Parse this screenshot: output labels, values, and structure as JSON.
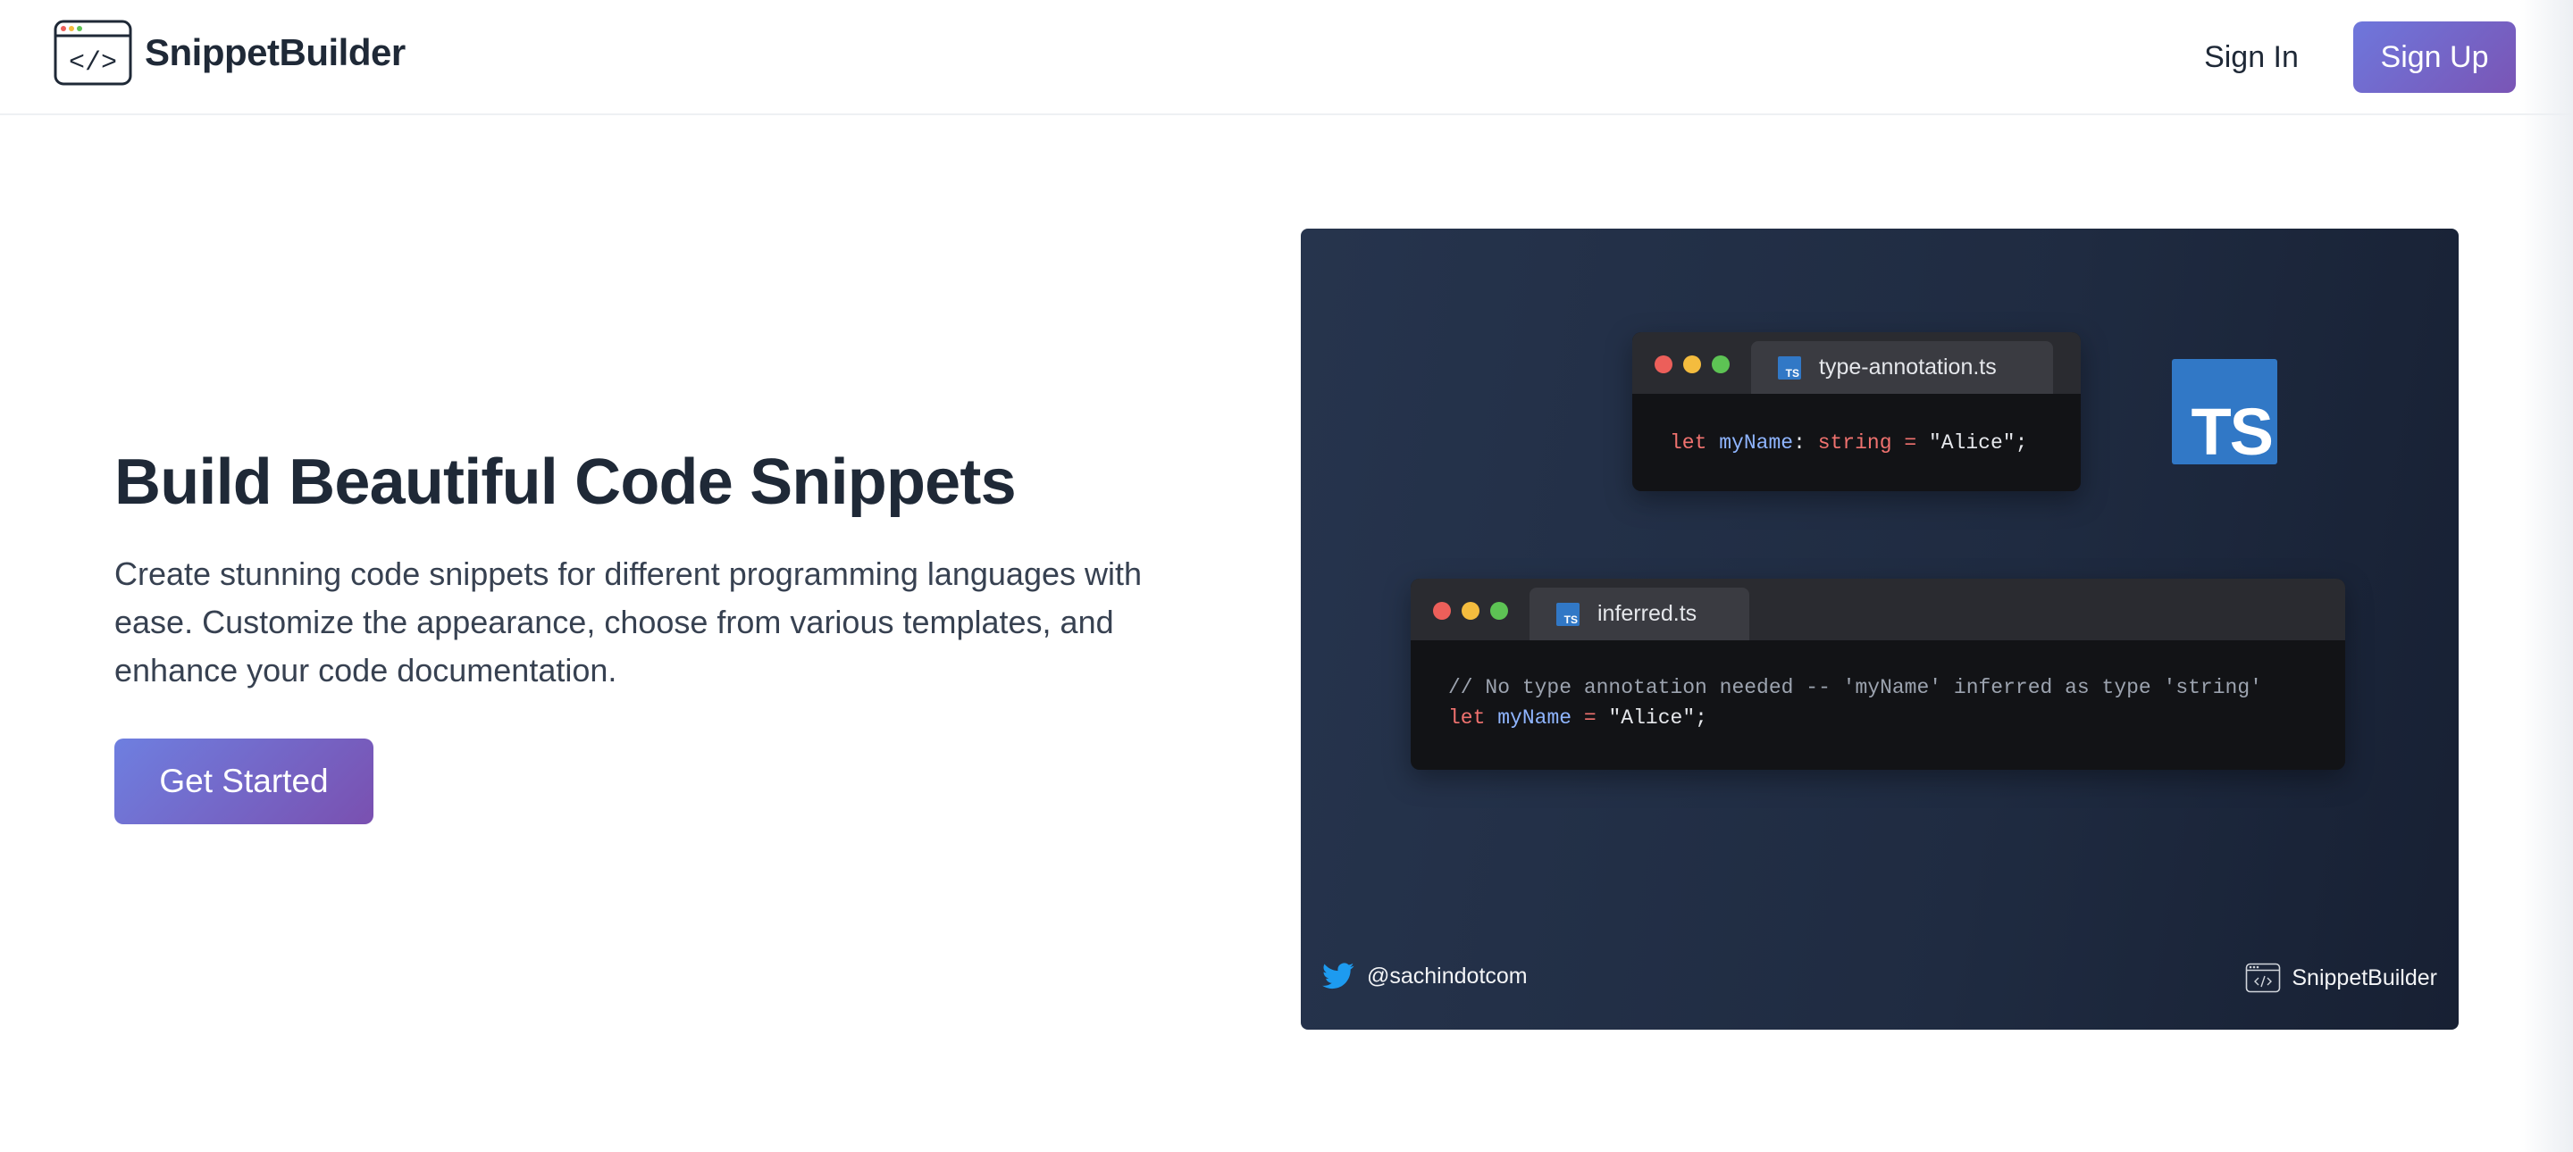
{
  "header": {
    "logo_text": "SnippetBuilder",
    "logo_glyph": "</>",
    "signin_label": "Sign In",
    "signup_label": "Sign Up"
  },
  "hero": {
    "title": "Build Beautiful Code Snippets",
    "description": "Create stunning code snippets for different programming languages with ease. Customize the appearance, choose from various templates, and enhance your code documentation.",
    "cta_label": "Get Started"
  },
  "preview": {
    "window1": {
      "filename": "type-annotation.ts",
      "code": {
        "kw": "let",
        "id": "myName",
        "colon": ":",
        "type": "string",
        "eq": "=",
        "value": "\"Alice\";"
      }
    },
    "window2": {
      "filename": "inferred.ts",
      "comment": "// No type annotation needed -- 'myName' inferred as type 'string'",
      "code": {
        "kw": "let",
        "id": "myName",
        "eq": "=",
        "value": "\"Alice\";"
      }
    },
    "ts_badge": "TS",
    "tab_badge": "TS",
    "twitter_handle": "@sachindotcom",
    "brand": "SnippetBuilder",
    "icons": {
      "logo": "code-window-icon",
      "twitter": "twitter-icon",
      "typescript": "typescript-icon"
    }
  },
  "colors": {
    "accent_start": "#6e77dc",
    "accent_end": "#7a55b5",
    "ts_blue": "#3178c6",
    "canvas_bg": "#1f2b41"
  }
}
